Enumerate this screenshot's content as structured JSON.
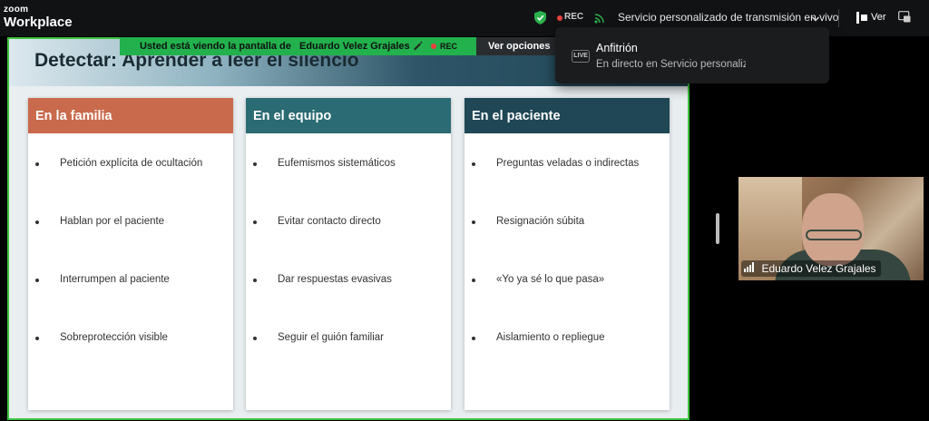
{
  "app": {
    "brand_small": "zoom",
    "brand_big": "Workplace"
  },
  "topbar": {
    "rec_label": "REC",
    "stream_title": "Servicio personalizado de transmisión en vivo",
    "view_label": "Ver"
  },
  "share_banner": {
    "text": "Usted está viendo la pantalla de",
    "presenter": "Eduardo Velez Grajales",
    "rec_label": "REC",
    "view_options": "Ver opciones"
  },
  "popup": {
    "badge": "LIVE",
    "title": "Anfitrión",
    "subtitle": "En directo en Servicio personaliza"
  },
  "slide": {
    "title": "Detectar: Aprender a leer el silencio",
    "columns": [
      {
        "header": "En la familia",
        "color": "#c96a4c",
        "items": [
          "Petición explícita de ocultación",
          "Hablan por el paciente",
          "Interrumpen al paciente",
          "Sobreprotección visible"
        ]
      },
      {
        "header": "En el equipo",
        "color": "#2b6b73",
        "items": [
          "Eufemismos sistemáticos",
          "Evitar contacto directo",
          "Dar respuestas evasivas",
          "Seguir el guión familiar"
        ]
      },
      {
        "header": "En el paciente",
        "color": "#1f4756",
        "items": [
          "Preguntas veladas o indirectas",
          "Resignación súbita",
          "«Yo ya sé lo que pasa»",
          "Aislamiento o repliegue"
        ]
      }
    ]
  },
  "participant": {
    "name": "Eduardo Velez Grajales"
  },
  "colors": {
    "share_green": "#22b14c",
    "rec_red": "#e8413b",
    "frame_border": "#3ec43e"
  },
  "icons": [
    "shield-check-icon",
    "stream-signal-icon",
    "chevron-down-icon",
    "view-icon",
    "picture-in-picture-icon",
    "drawing-pen-icon",
    "signal-bars-icon"
  ]
}
